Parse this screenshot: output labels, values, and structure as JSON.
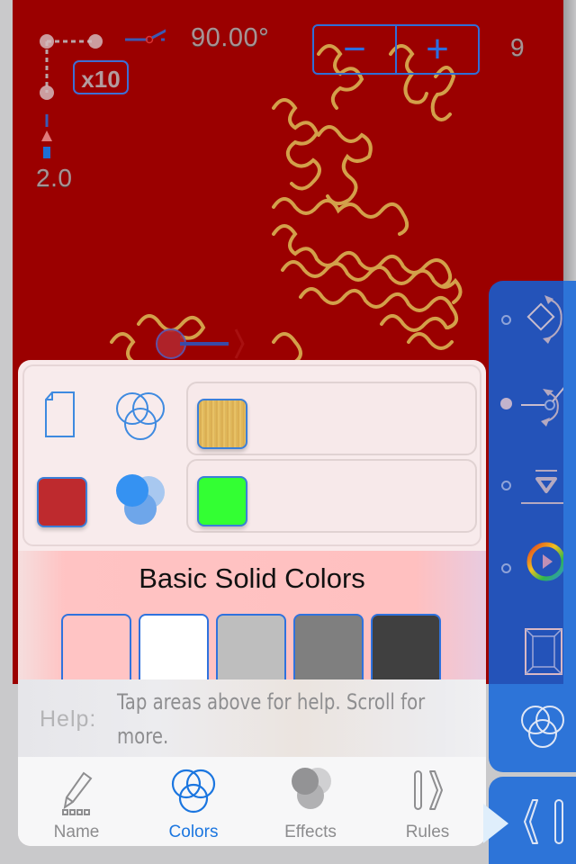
{
  "canvas": {
    "background_color": "#9b0000",
    "curve_color": "#d9a54a",
    "angle_readout": "90.00°",
    "depth_readout": "9",
    "scale_readout": "2.0",
    "multiplier_label": "x10",
    "stepper": {
      "minus_label": "−",
      "plus_label": "+"
    }
  },
  "colors_panel": {
    "row1": {
      "icon": "blank-page-icon",
      "mode_icon": "three-circles-outline-icon",
      "swatch": {
        "name": "gold-texture",
        "color": "#d9b25a"
      }
    },
    "row2": {
      "background_swatch": "#be2a2e",
      "mode_icon": "three-circles-filled-icon",
      "swatch": {
        "name": "green",
        "color": "#33ff33"
      }
    },
    "basic_title": "Basic Solid Colors",
    "basic_swatches": [
      "#ffc4c4",
      "#ffffff",
      "#bebebe",
      "#7f7f7f",
      "#404040"
    ]
  },
  "help": {
    "label": "Help:",
    "text": "Tap areas above for help. Scroll for more."
  },
  "tabs": [
    {
      "label": "Name",
      "icon": "pencil-icon",
      "active": false
    },
    {
      "label": "Colors",
      "icon": "three-circles-icon",
      "active": true
    },
    {
      "label": "Effects",
      "icon": "overlapping-circles-icon",
      "active": false
    },
    {
      "label": "Rules",
      "icon": "bracket-chevron-icon",
      "active": false
    }
  ],
  "right_toolbar": {
    "tools": [
      {
        "name": "rotate-shape",
        "selected": false
      },
      {
        "name": "angle",
        "selected": true
      },
      {
        "name": "baseline",
        "selected": false
      },
      {
        "name": "hue-wheel",
        "selected": false
      },
      {
        "name": "frame",
        "selected": false
      }
    ],
    "colors_button": "three-circles-icon",
    "rules_button": "chevron-bracket-icon"
  }
}
